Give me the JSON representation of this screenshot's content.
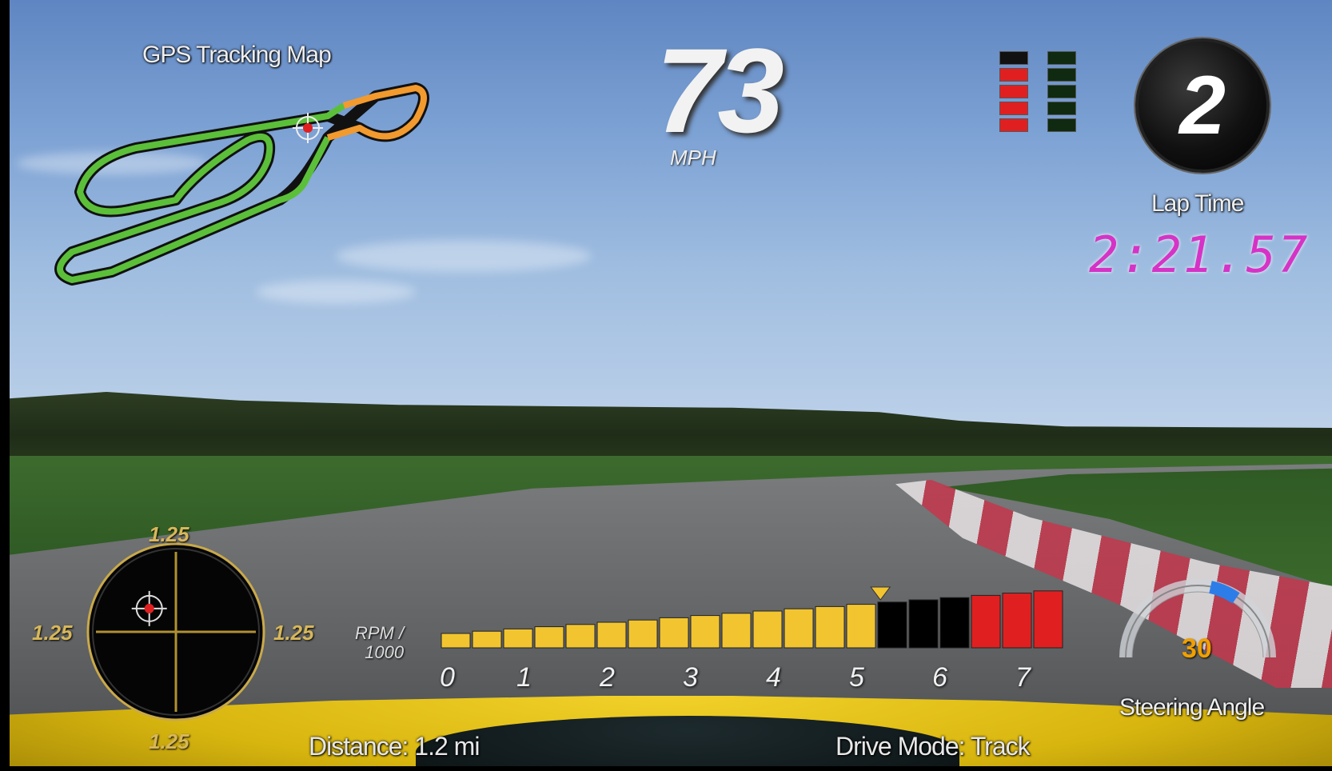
{
  "map": {
    "title": "GPS Tracking Map",
    "colors": {
      "track_done": "#5bbf3a",
      "track_remaining": "#f29a2e",
      "marker": "#e02020"
    }
  },
  "speed": {
    "value": "73",
    "unit": "MPH"
  },
  "shift_lights": {
    "left_column_colors": [
      "#111111",
      "#e02020",
      "#e02020",
      "#e02020",
      "#e02020"
    ],
    "right_column_colors": [
      "#0f2a10",
      "#0f2a10",
      "#0f2a10",
      "#0f2a10",
      "#0f2a10"
    ]
  },
  "gear": {
    "value": "2"
  },
  "lap": {
    "label": "Lap Time",
    "time": "2:21.57"
  },
  "gforce": {
    "top": "1.25",
    "bottom": "1.25",
    "left": "1.25",
    "right": "1.25",
    "marker_offset": {
      "x_g": -0.4,
      "y_g": 0.35
    }
  },
  "rpm": {
    "label_line1": "RPM /",
    "label_line2": "1000",
    "ticks": [
      "0",
      "1",
      "2",
      "3",
      "4",
      "5",
      "6",
      "7"
    ],
    "current_krpm": 5.3,
    "max_krpm": 7.5,
    "colors": {
      "normal": "#f2c530",
      "upper": "#000000",
      "redline": "#e02020"
    }
  },
  "steering": {
    "value": "30",
    "label": "Steering Angle"
  },
  "footer": {
    "distance": "Distance: 1.2 mi",
    "drive_mode": "Drive Mode: Track"
  }
}
